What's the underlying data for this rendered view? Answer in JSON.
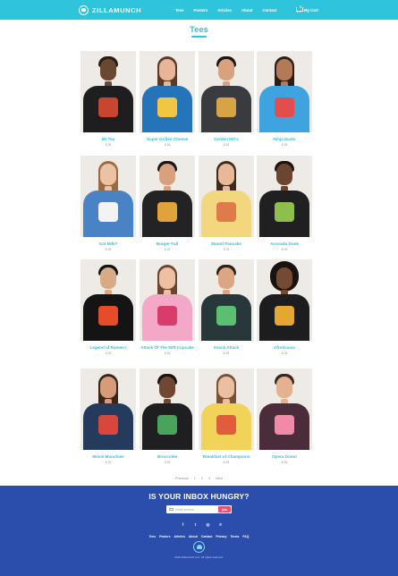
{
  "header": {
    "brand": "ZILLAMUNCH",
    "nav": [
      "Tees",
      "Posters",
      "Articles",
      "About",
      "Contact"
    ],
    "cart_label": "My Cart",
    "cart_count": "0"
  },
  "page": {
    "title": "Tees"
  },
  "products": [
    {
      "name": "Mr Tea",
      "price": "$ 28"
    },
    {
      "name": "Super Grilled Cheese",
      "price": "$ 28"
    },
    {
      "name": "Golden MC's",
      "price": "$ 28"
    },
    {
      "name": "Ninja Sushi",
      "price": "$ 28"
    },
    {
      "name": "Got Milk?",
      "price": "$ 28"
    },
    {
      "name": "Burger Fall",
      "price": "$ 28"
    },
    {
      "name": "Mount Pancake",
      "price": "$ 28"
    },
    {
      "name": "Avocado Dunk",
      "price": "$ 28"
    },
    {
      "name": "Legend of Ramen I",
      "price": "$ 28"
    },
    {
      "name": "Attack Of The 50ft Cupcake",
      "price": "$ 28"
    },
    {
      "name": "Snack Attack",
      "price": "$ 28"
    },
    {
      "name": "Afrolicious",
      "price": "$ 28"
    },
    {
      "name": "Movie Munchies",
      "price": "$ 28"
    },
    {
      "name": "Broccolee",
      "price": "$ 28"
    },
    {
      "name": "Breakfast of Champions",
      "price": "$ 28"
    },
    {
      "name": "Opera Donut",
      "price": "$ 28"
    }
  ],
  "product_visuals": [
    {
      "skin": "#6b4630",
      "hair": "#2a1c14",
      "shirt": "#1e1e20",
      "print": "#c8462f",
      "style": "short"
    },
    {
      "skin": "#e7b597",
      "hair": "#5b3b25",
      "shirt": "#2573b8",
      "print": "#f2c640",
      "style": "long"
    },
    {
      "skin": "#d9a27e",
      "hair": "#1a1412",
      "shirt": "#3a3b3e",
      "print": "#d8a346",
      "style": "short"
    },
    {
      "skin": "#b27a57",
      "hair": "#2e1d15",
      "shirt": "#3fa3df",
      "print": "#e44d4d",
      "style": "long"
    },
    {
      "skin": "#ecc2a4",
      "hair": "#9a6a42",
      "shirt": "#4a82c6",
      "print": "#f3f3f3",
      "style": "long"
    },
    {
      "skin": "#d8a07c",
      "hair": "#1d1612",
      "shirt": "#232325",
      "print": "#e0a23a",
      "style": "short"
    },
    {
      "skin": "#e8b899",
      "hair": "#3f2a1d",
      "shirt": "#f2d77e",
      "print": "#e07a4a",
      "style": "long"
    },
    {
      "skin": "#6c4532",
      "hair": "#1c130e",
      "shirt": "#202022",
      "print": "#8cc04a",
      "style": "short"
    },
    {
      "skin": "#d8ab86",
      "hair": "#141111",
      "shirt": "#141414",
      "print": "#e74c2a",
      "style": "short"
    },
    {
      "skin": "#eebfa2",
      "hair": "#6b4630",
      "shirt": "#f3a8c8",
      "print": "#d83c6b",
      "style": "long"
    },
    {
      "skin": "#dca584",
      "hair": "#2c1f16",
      "shirt": "#28373a",
      "print": "#5bbf71",
      "style": "short"
    },
    {
      "skin": "#754a33",
      "hair": "#1a1210",
      "shirt": "#1d1d1f",
      "print": "#e4a733",
      "style": "afro"
    },
    {
      "skin": "#d69b78",
      "hair": "#3a2518",
      "shirt": "#253b5e",
      "print": "#d9473c",
      "style": "long"
    },
    {
      "skin": "#6f4733",
      "hair": "#1b1310",
      "shirt": "#1f1f21",
      "print": "#4aa35b",
      "style": "short"
    },
    {
      "skin": "#ebbf9f",
      "hair": "#7a5236",
      "shirt": "#f2d35a",
      "print": "#e05c3d",
      "style": "long"
    },
    {
      "skin": "#e4b192",
      "hair": "#3a271b",
      "shirt": "#4a2c3a",
      "print": "#ef8aa8",
      "style": "short"
    }
  ],
  "pagination": [
    "Previous",
    "1",
    "2",
    "3",
    "Next"
  ],
  "footer": {
    "title": "IS YOUR INBOX HUNGRY?",
    "email_placeholder": "email address",
    "join_label": "join",
    "links": [
      "Tees",
      "Posters",
      "Articles",
      "About",
      "Contact",
      "Privacy",
      "Terms",
      "FAQ"
    ],
    "copyright": "2016 Zillamunch LLC. All rights reserved.",
    "social_icons": [
      "facebook-icon",
      "twitter-icon",
      "instagram-icon",
      "pinterest-icon"
    ]
  },
  "colors": {
    "accent": "#2ec4dc",
    "footer_bg": "#2b4dab",
    "join_button": "#ef4f6d"
  }
}
